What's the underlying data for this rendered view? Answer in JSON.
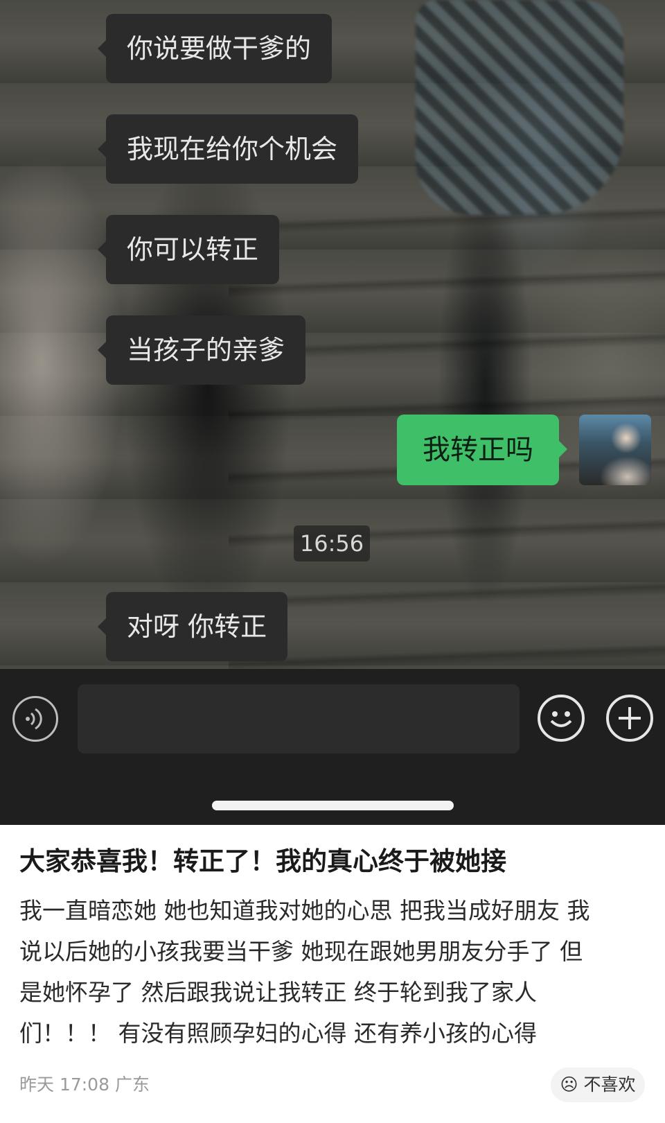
{
  "chat": {
    "messages_in": [
      {
        "text": "你说要做干爹的"
      },
      {
        "text": "我现在给你个机会"
      },
      {
        "text": "你可以转正"
      },
      {
        "text": "当孩子的亲爹"
      }
    ],
    "message_out": {
      "text": "我转正吗"
    },
    "timestamp": "16:56",
    "message_after": {
      "text": "对呀 你转正"
    },
    "colors": {
      "incoming_bubble": "#2b2b2b",
      "outgoing_bubble": "#3fbf68",
      "input_bar": "#1f1f1f"
    },
    "icons": {
      "voice": "voice-icon",
      "emoji": "emoji-icon",
      "plus": "plus-icon"
    }
  },
  "post": {
    "title": "大家恭喜我！转正了！我的真心终于被她接",
    "body_lines": [
      "我一直暗恋她 她也知道我对她的心思 把我当成好朋友 我",
      "说以后她的小孩我要当干爹 她现在跟她男朋友分手了 但",
      "是她怀孕了 然后跟我说让我转正 终于轮到我了家人",
      "们！！！ 有没有照顾孕妇的心得 还有养小孩的心得"
    ],
    "meta": "昨天 17:08 广东",
    "dislike_label": "不喜欢"
  }
}
